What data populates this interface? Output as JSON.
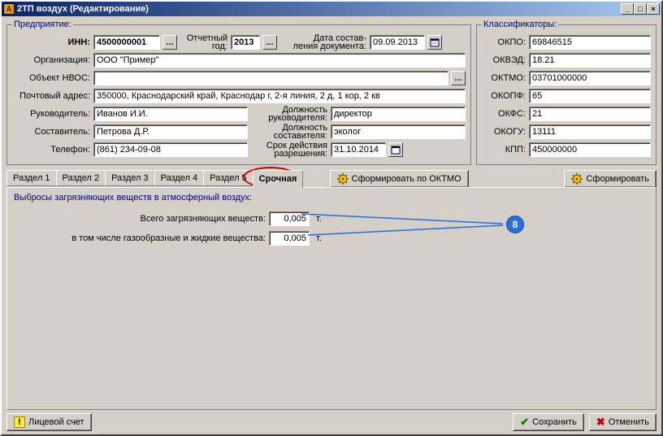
{
  "window": {
    "title": "2ТП воздух (Редактирование)"
  },
  "enterprise": {
    "legend": "Предприятие:",
    "inn_label": "ИНН:",
    "inn": "4500000001",
    "report_year_label_l1": "Отчетный",
    "report_year_label_l2": "год:",
    "report_year": "2013",
    "doc_date_label_l1": "Дата состав-",
    "doc_date_label_l2": "ления документа:",
    "doc_date": "09.09.2013",
    "org_label": "Организация:",
    "org": "ООО \"Пример\"",
    "nvos_label": "Объект НВОС:",
    "nvos": "",
    "postaddr_label": "Почтовый адрес:",
    "postaddr": "350000, Краснодарский край, Краснодар г, 2-я линия, 2 д, 1 кор, 2 кв",
    "head_label": "Руководитель:",
    "head": "Иванов И.И.",
    "head_pos_label_l1": "Должность",
    "head_pos_label_l2": "руководителя:",
    "head_pos": "директор",
    "compiler_label": "Составитель:",
    "compiler": "Петрова Д.Р.",
    "compiler_pos_label_l1": "Должность",
    "compiler_pos_label_l2": "составителя:",
    "compiler_pos": "эколог",
    "phone_label": "Телефон:",
    "phone": "(861) 234-09-08",
    "permit_label_l1": "Срок действия",
    "permit_label_l2": "разрешения:",
    "permit_date": "31.10.2014"
  },
  "classifiers": {
    "legend": "Классификаторы:",
    "okpo_label": "ОКПО:",
    "okpo": "69846515",
    "okved_label": "ОКВЭД:",
    "okved": "18.21",
    "oktmo_label": "ОКТМО:",
    "oktmo": "03701000000",
    "okopf_label": "ОКОПФ:",
    "okopf": "65",
    "okfs_label": "ОКФС:",
    "okfs": "21",
    "okogu_label": "ОКОГУ:",
    "okogu": "13111",
    "kpp_label": "КПП:",
    "kpp": "450000000"
  },
  "tabs": {
    "r1": "Раздел 1",
    "r2": "Раздел 2",
    "r3": "Раздел 3",
    "r4": "Раздел 4",
    "r5": "Раздел 5",
    "urgent": "Срочная"
  },
  "toolbar": {
    "form_oktmo": "Сформировать по ОКТМО",
    "form": "Сформировать"
  },
  "page": {
    "legend": "Выбросы загрязняющих веществ в атмосферный воздух:",
    "total_label": "Всего загрязняющих веществ:",
    "total": "0,005",
    "unit_t": "т.",
    "gasliq_label": "в том числе газообразные и жидкие вещества:",
    "gasliq": "0,005"
  },
  "footer": {
    "account": "Лицевой счет",
    "save": "Сохранить",
    "cancel": "Отменить"
  },
  "callout": {
    "num": "8"
  }
}
